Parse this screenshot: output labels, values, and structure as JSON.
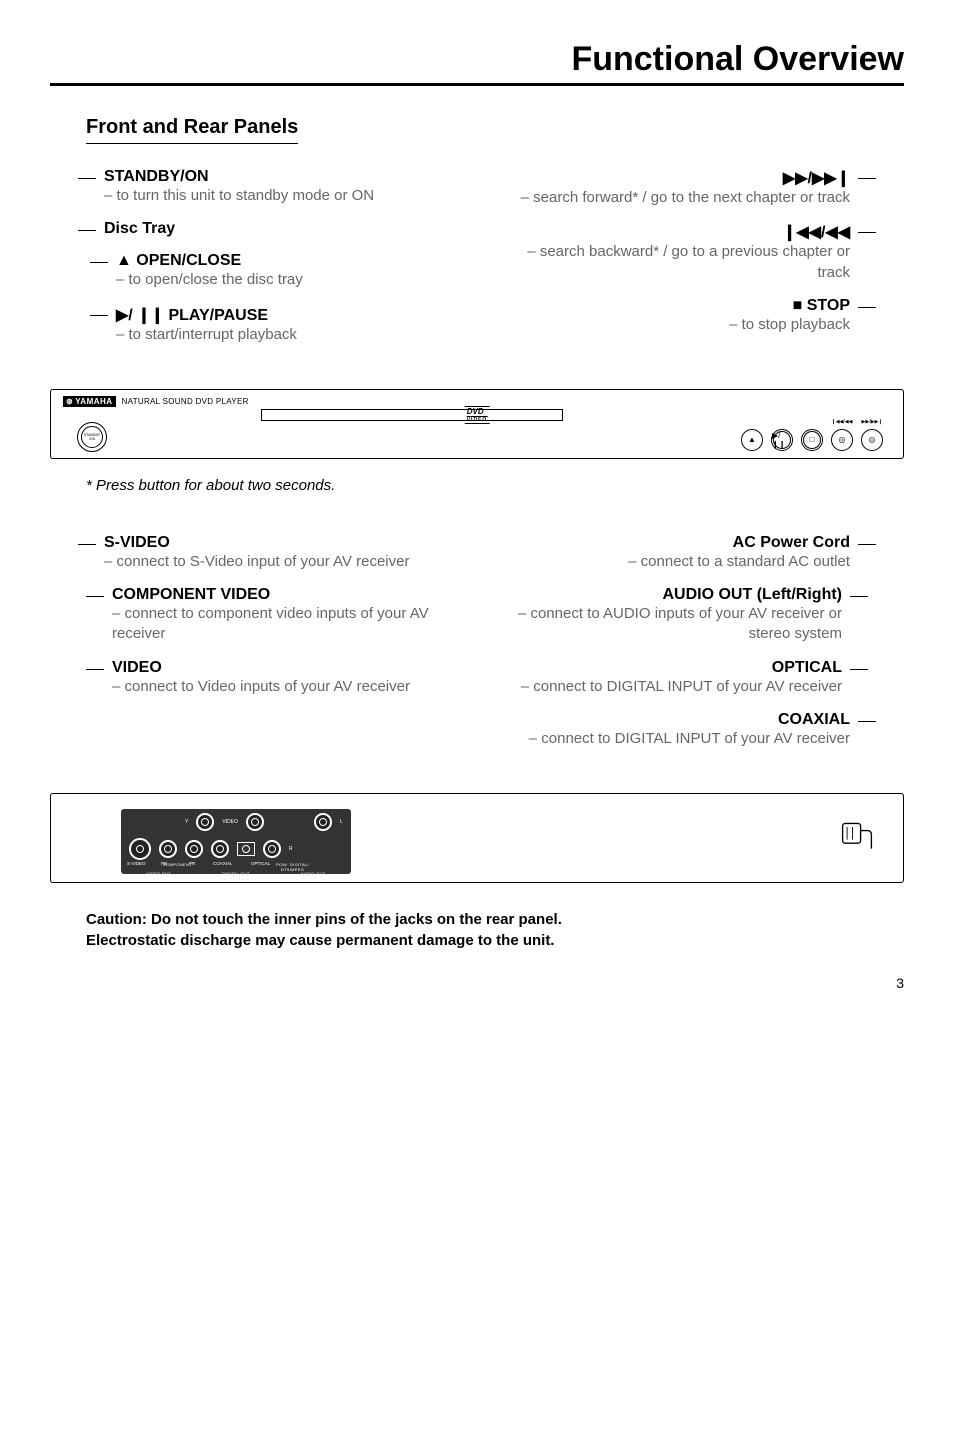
{
  "page": {
    "title": "Functional Overview",
    "section": "Front and Rear Panels",
    "footnote": "* Press button for about two seconds.",
    "caution_line1": "Caution: Do not touch the inner pins of the jacks on the rear panel.",
    "caution_line2": "Electrostatic discharge may cause permanent damage to the unit.",
    "page_number": "3"
  },
  "front_panel": {
    "logo_brand": "YAMAHA",
    "logo_tag": "NATURAL SOUND DVD PLAYER",
    "dvd_badge": "DVD",
    "dvd_badge_sub": "VIDEO",
    "left": [
      {
        "head": "STANDBY/ON",
        "desc": "– to turn this unit to standby mode or ON"
      },
      {
        "head": "Disc Tray",
        "desc": ""
      },
      {
        "head": "▲ OPEN/CLOSE",
        "desc": "– to open/close the disc tray"
      },
      {
        "head": "▶/ ❙❙ PLAY/PAUSE",
        "desc": "– to start/interrupt playback"
      }
    ],
    "right": [
      {
        "head": "▶▶/▶▶❙",
        "desc": "– search forward* / go to the next chapter or track"
      },
      {
        "head": "❙◀◀/◀◀",
        "desc": "– search backward* / go to a previous chapter or track"
      },
      {
        "head": "■ STOP",
        "desc": "– to stop playback"
      }
    ],
    "btn_labels": {
      "skip_back": "❙◀◀/◀◀",
      "skip_fwd": "▶▶/▶▶❙"
    }
  },
  "rear_panel": {
    "left": [
      {
        "head": "S-VIDEO",
        "desc": "– connect to S-Video input of your AV receiver"
      },
      {
        "head": "COMPONENT VIDEO",
        "desc": "– connect to component video inputs of your AV receiver"
      },
      {
        "head": "VIDEO",
        "desc": "– connect to Video inputs of your AV receiver"
      }
    ],
    "right": [
      {
        "head": "AC Power Cord",
        "desc": "– connect to a standard AC outlet"
      },
      {
        "head": "AUDIO OUT (Left/Right)",
        "desc": "– connect to AUDIO inputs of your AV receiver or stereo system"
      },
      {
        "head": "OPTICAL",
        "desc": "– connect to DIGITAL INPUT of your AV receiver"
      },
      {
        "head": "COAXIAL",
        "desc": "– connect to DIGITAL INPUT of your AV receiver"
      }
    ],
    "jack_labels": {
      "y": "Y",
      "video": "VIDEO",
      "svideo": "S-VIDEO",
      "pb": "PB",
      "pr": "PR",
      "coaxial": "COAXIAL",
      "optical": "OPTICAL",
      "component": "COMPONENT",
      "pcm": "PCM/  DIGITAL/\nDTS/MPEG",
      "video_out": "VIDEO OUT",
      "digital_out": "DIGITAL OUT",
      "audio_out": "AUDIO OUT",
      "l": "L",
      "r": "R"
    }
  }
}
